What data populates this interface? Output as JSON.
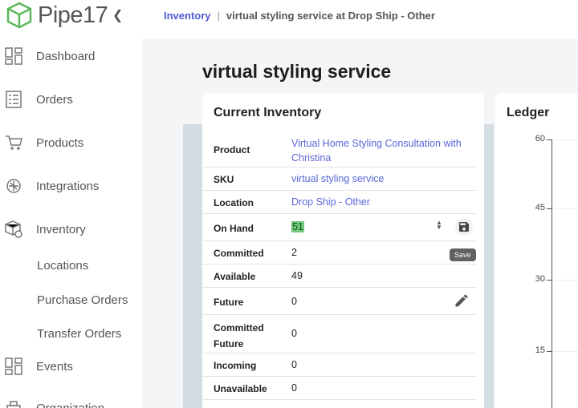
{
  "app": {
    "name": "Pipe17",
    "collapse_icon": "chevron-left-icon"
  },
  "sidebar": {
    "items": [
      {
        "label": "Dashboard",
        "icon": "dashboard-icon"
      },
      {
        "label": "Orders",
        "icon": "orders-icon"
      },
      {
        "label": "Products",
        "icon": "cart-icon"
      },
      {
        "label": "Integrations",
        "icon": "integrations-icon"
      },
      {
        "label": "Inventory",
        "icon": "inventory-icon"
      },
      {
        "label": "Events",
        "icon": "events-icon"
      },
      {
        "label": "Organization",
        "icon": "organization-icon"
      }
    ],
    "sub_items": [
      "Locations",
      "Purchase Orders",
      "Transfer Orders"
    ]
  },
  "breadcrumb": {
    "link": "Inventory",
    "separator": "|",
    "current": "virtual styling service at Drop Ship - Other"
  },
  "page": {
    "title": "virtual styling service"
  },
  "inventory_card": {
    "title": "Current Inventory",
    "rows": [
      {
        "key": "Product",
        "value": "Virtual Home Styling Consultation with Christina"
      },
      {
        "key": "SKU",
        "value": "virtual styling service"
      },
      {
        "key": "Location",
        "value": "Drop Ship - Other"
      },
      {
        "key": "On Hand",
        "value": "51"
      },
      {
        "key": "Committed",
        "value": "2"
      },
      {
        "key": "Available",
        "value": "49"
      },
      {
        "key": "Future",
        "value": "0"
      },
      {
        "key": "Committed Future",
        "value": "0"
      },
      {
        "key": "Incoming",
        "value": "0"
      },
      {
        "key": "Unavailable",
        "value": "0"
      }
    ],
    "save_tooltip": "Save"
  },
  "ledger": {
    "title": "Ledger",
    "y_ticks": [
      "60",
      "45",
      "30",
      "15"
    ]
  },
  "colors": {
    "accent": "#4c5bd4",
    "link": "#5a67d8",
    "highlight": "#6ec97a"
  }
}
